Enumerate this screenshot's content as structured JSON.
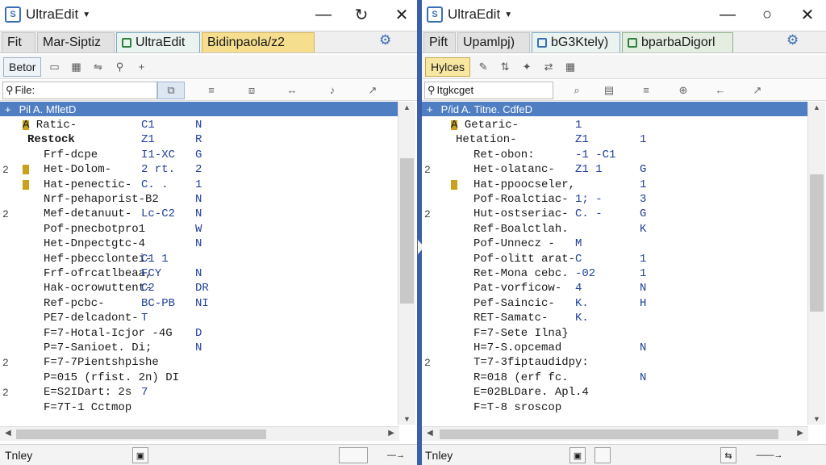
{
  "left": {
    "title": "UltraEdit",
    "tabs": [
      "Fit",
      "Mar-Siptiz",
      "UltraEdit",
      "Bidinpaola/z2"
    ],
    "toolbar_button": "Betor",
    "filter_label": "File:",
    "group_header": "Pil A. MfletD",
    "group_expander": "+",
    "rows": [
      {
        "mark": "",
        "text": "A Ratic-",
        "t2": "C1",
        "t3": "N",
        "sq": true,
        "bold": false
      },
      {
        "mark": "",
        "text": "Restock",
        "t2": "Z1",
        "t3": "R",
        "sq": false,
        "bold": true
      },
      {
        "mark": "",
        "text": "Frf-dcpe",
        "t2": "I1-XC",
        "t3": "G",
        "sq": false,
        "bold": false
      },
      {
        "mark": "2",
        "text": "Het-Dolom-",
        "t2": "2 rt.",
        "t3": "2",
        "sq": true,
        "bold": false
      },
      {
        "mark": "",
        "text": "Hat-penectic-",
        "t2": "C. .",
        "t3": "1",
        "sq": true,
        "bold": false
      },
      {
        "mark": "",
        "text": "Nrf-pehaporist-B2",
        "t2": "",
        "t3": "N",
        "sq": false,
        "bold": false
      },
      {
        "mark": "2",
        "text": "Mef-detanuut-",
        "t2": "Lc-C2",
        "t3": "N",
        "sq": false,
        "bold": false
      },
      {
        "mark": "",
        "text": "Pof-pnecbotpro1",
        "t2": "",
        "t3": "W",
        "sq": false,
        "bold": false
      },
      {
        "mark": "",
        "text": "Het-Dnpectgtc-4",
        "t2": "",
        "t3": "N",
        "sq": false,
        "bold": false
      },
      {
        "mark": "",
        "text": "Hef-pbecclontei-",
        "t2": "C1 1",
        "t3": "",
        "sq": false,
        "bold": false
      },
      {
        "mark": "",
        "text": "Frf-ofrcatlbeaa,",
        "t2": "FCY",
        "t3": "N",
        "sq": false,
        "bold": false
      },
      {
        "mark": "",
        "text": "Hak-ocrowuttent-",
        "t2": "C2",
        "t3": "DR",
        "sq": false,
        "bold": false
      },
      {
        "mark": "",
        "text": "Ref-pcbc-",
        "t2": "BC-PB",
        "t3": "NI",
        "sq": false,
        "bold": false
      },
      {
        "mark": "",
        "text": "PE7-delcadont-",
        "t2": "T",
        "t3": "",
        "sq": false,
        "bold": false
      },
      {
        "mark": "",
        "text": "F=7-Hotal-Icjor -4G",
        "t2": "",
        "t3": "D",
        "sq": false,
        "bold": false
      },
      {
        "mark": "",
        "text": "P=7-Sanioet. Di;",
        "t2": "",
        "t3": "N",
        "sq": false,
        "bold": false
      },
      {
        "mark": "2",
        "text": "F=7-7Pientshpishe",
        "t2": "",
        "t3": "",
        "sq": false,
        "bold": false
      },
      {
        "mark": "",
        "text": "P=015 (rfist. 2n) DI",
        "t2": "",
        "t3": "",
        "sq": false,
        "bold": false
      },
      {
        "mark": "2",
        "text": "E=S2IDart: 2s",
        "t2": "7",
        "t3": "",
        "sq": false,
        "bold": false
      },
      {
        "mark": "",
        "text": "F=7T-1 Cctmop",
        "t2": "",
        "t3": "",
        "sq": false,
        "bold": false
      }
    ],
    "status_text": "Tnley"
  },
  "right": {
    "title": "UltraEdit",
    "tabs": [
      "Pift",
      "Upamlpj)",
      "bG3Ktely)",
      "bparbaDigorl"
    ],
    "toolbar_button": "Hylces",
    "filter_label": "Itgkcget",
    "group_header": "P/id A. Titne. CdfeD",
    "group_expander": "+",
    "rows": [
      {
        "mark": "",
        "text": "A Getaric-",
        "t2": "1",
        "t3": "",
        "sq": true,
        "bold": false
      },
      {
        "mark": "",
        "text": "Hetation-",
        "t2": "Z1",
        "t3": "1",
        "sq": false,
        "bold": false
      },
      {
        "mark": "",
        "text": "Ret-obon:",
        "t2": "-1 -C1",
        "t3": "",
        "sq": false,
        "bold": false
      },
      {
        "mark": "2",
        "text": "Het-olatanc-",
        "t2": "Z1 1",
        "t3": "G",
        "sq": false,
        "bold": false
      },
      {
        "mark": "",
        "text": "Hat-ppoocseler,",
        "t2": "",
        "t3": "1",
        "sq": true,
        "bold": false
      },
      {
        "mark": "",
        "text": "Pof-Roalctiac-",
        "t2": "1; -",
        "t3": "3",
        "sq": false,
        "bold": false
      },
      {
        "mark": "2",
        "text": "Hut-ostseriac-",
        "t2": "C. -",
        "t3": "G",
        "sq": false,
        "bold": false
      },
      {
        "mark": "",
        "text": "Ref-Boalctlah.",
        "t2": "",
        "t3": "K",
        "sq": false,
        "bold": false
      },
      {
        "mark": "",
        "text": "Pof-Unnecz -",
        "t2": "M",
        "t3": "",
        "sq": false,
        "bold": false
      },
      {
        "mark": "",
        "text": "Pof-olitt arat-",
        "t2": "C",
        "t3": "1",
        "sq": false,
        "bold": false
      },
      {
        "mark": "",
        "text": "Ret-Mona cebc.",
        "t2": "-02",
        "t3": "1",
        "sq": false,
        "bold": false
      },
      {
        "mark": "",
        "text": "Pat-vorficow-",
        "t2": "4",
        "t3": "N",
        "sq": false,
        "bold": false
      },
      {
        "mark": "",
        "text": "Pef-Saincic-",
        "t2": "K.",
        "t3": "H",
        "sq": false,
        "bold": false
      },
      {
        "mark": "",
        "text": "RET-Samatc-",
        "t2": "K.",
        "t3": "",
        "sq": false,
        "bold": false
      },
      {
        "mark": "",
        "text": "F=7-Sete Ilna}",
        "t2": "",
        "t3": "",
        "sq": false,
        "bold": false
      },
      {
        "mark": "",
        "text": "H=7-S.opcemad",
        "t2": "",
        "t3": "N",
        "sq": false,
        "bold": false
      },
      {
        "mark": "2",
        "text": "T=7-3fiptaudidpy:",
        "t2": "",
        "t3": "",
        "sq": false,
        "bold": false
      },
      {
        "mark": "",
        "text": "R=018 (erf fc.",
        "t2": "",
        "t3": "N",
        "sq": false,
        "bold": false
      },
      {
        "mark": "",
        "text": "E=02BLDare. Apl.4",
        "t2": "",
        "t3": "",
        "sq": false,
        "bold": false
      },
      {
        "mark": "",
        "text": "F=T-8 sroscop",
        "t2": "",
        "t3": "",
        "sq": false,
        "bold": false
      }
    ],
    "status_text": "Tnley"
  }
}
